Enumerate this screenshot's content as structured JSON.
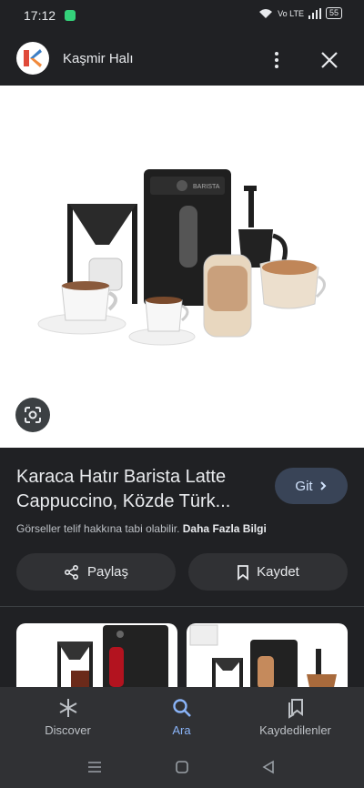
{
  "status": {
    "time": "17:12",
    "network": "Vo LTE",
    "battery": "55"
  },
  "header": {
    "site_name": "Kaşmir Halı"
  },
  "result": {
    "title": "Karaca Hatır Barista Latte Cappuccino, Közde Türk...",
    "go_label": "Git",
    "copyright_notice": "Görseller telif hakkına tabi olabilir.",
    "more_info": "Daha Fazla Bilgi",
    "share_label": "Paylaş",
    "save_label": "Kaydet"
  },
  "product_image": {
    "brand_label": "BARISTA"
  },
  "bottom_nav": {
    "items": [
      {
        "label": "Discover",
        "icon": "asterisk-icon"
      },
      {
        "label": "Ara",
        "icon": "search-icon"
      },
      {
        "label": "Kaydedilenler",
        "icon": "collections-icon"
      }
    ],
    "active": "Ara"
  },
  "colors": {
    "background": "#202124",
    "surface": "#303134",
    "accent": "#8ab4f8",
    "go_button": "#394457"
  }
}
